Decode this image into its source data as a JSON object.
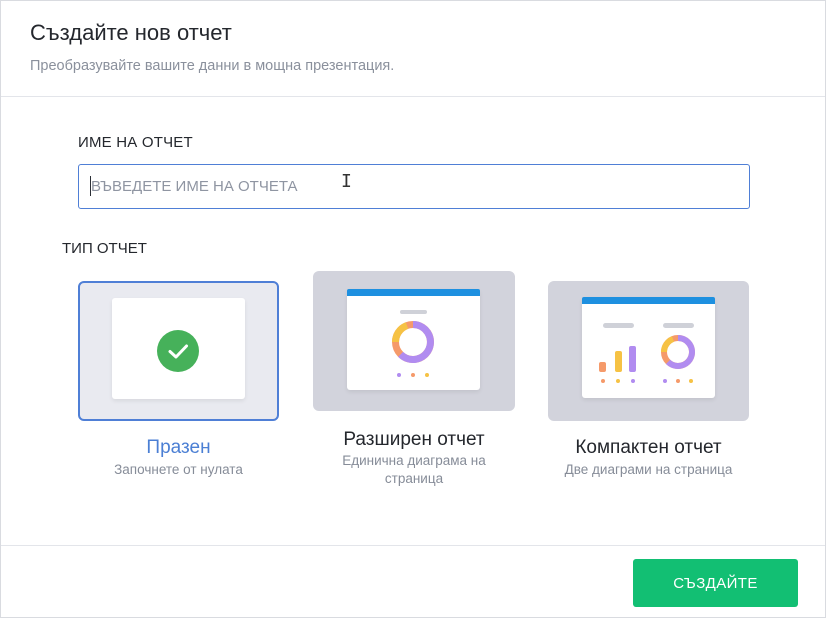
{
  "dialog": {
    "title": "Създайте нов отчет",
    "subtitle": "Преобразувайте вашите данни в мощна презентация."
  },
  "report_name": {
    "label": "ИМЕ НА ОТЧЕТ",
    "value": "",
    "placeholder": "ВЪВЕДЕТЕ ИМЕ НА ОТЧЕТА"
  },
  "report_type": {
    "label": "ТИП ОТЧЕТ",
    "options": [
      {
        "name": "Празен",
        "description": "Започнете от нулата",
        "selected": true,
        "icon": "check-icon"
      },
      {
        "name": "Разширен отчет",
        "description": "Единична диаграма на страница",
        "selected": false,
        "icon": "single-chart-preview-icon"
      },
      {
        "name": "Компактен отчет",
        "description": "Две диаграми на страница",
        "selected": false,
        "icon": "two-charts-preview-icon"
      }
    ]
  },
  "footer": {
    "create_label": "СЪЗДАЙТЕ"
  },
  "colors": {
    "accent": "#4f7fd6",
    "create_button": "#12bf73",
    "check": "#46b15a",
    "chart_blue": "#1e90e0",
    "chart_purple": "#b18cf0",
    "chart_orange": "#f59a6a",
    "chart_yellow": "#f6c244"
  }
}
